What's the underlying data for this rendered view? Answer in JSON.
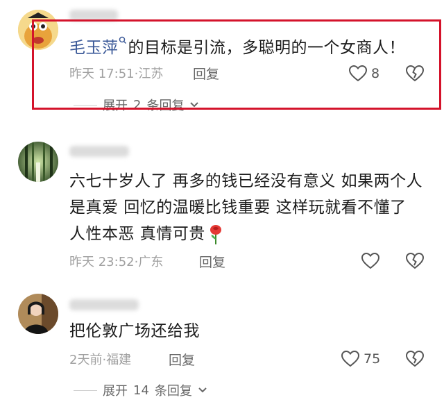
{
  "comments": [
    {
      "mention": "毛玉萍",
      "text": "的目标是引流，多聪明的一个女商人！",
      "time": "昨天 17:51",
      "location": "江苏",
      "reply_label": "回复",
      "likes": "8",
      "expand": {
        "prefix": "展开",
        "count": "2",
        "suffix": "条回复"
      }
    },
    {
      "text": "六七十岁人了 再多的钱已经没有意义 如果两个人是真爱 回忆的温暖比钱重要 这样玩就看不懂了 人性本恶 真情可贵",
      "time": "昨天 23:52",
      "location": "广东",
      "reply_label": "回复"
    },
    {
      "text": "把伦敦广场还给我",
      "time": "2天前",
      "location": "福建",
      "reply_label": "回复",
      "likes": "75",
      "expand": {
        "prefix": "展开",
        "count": "14",
        "suffix": "条回复"
      }
    }
  ],
  "meta_separator": "·",
  "colors": {
    "highlight": "#d4132b",
    "mention": "#3b5998",
    "meta": "#a0a0a0"
  }
}
